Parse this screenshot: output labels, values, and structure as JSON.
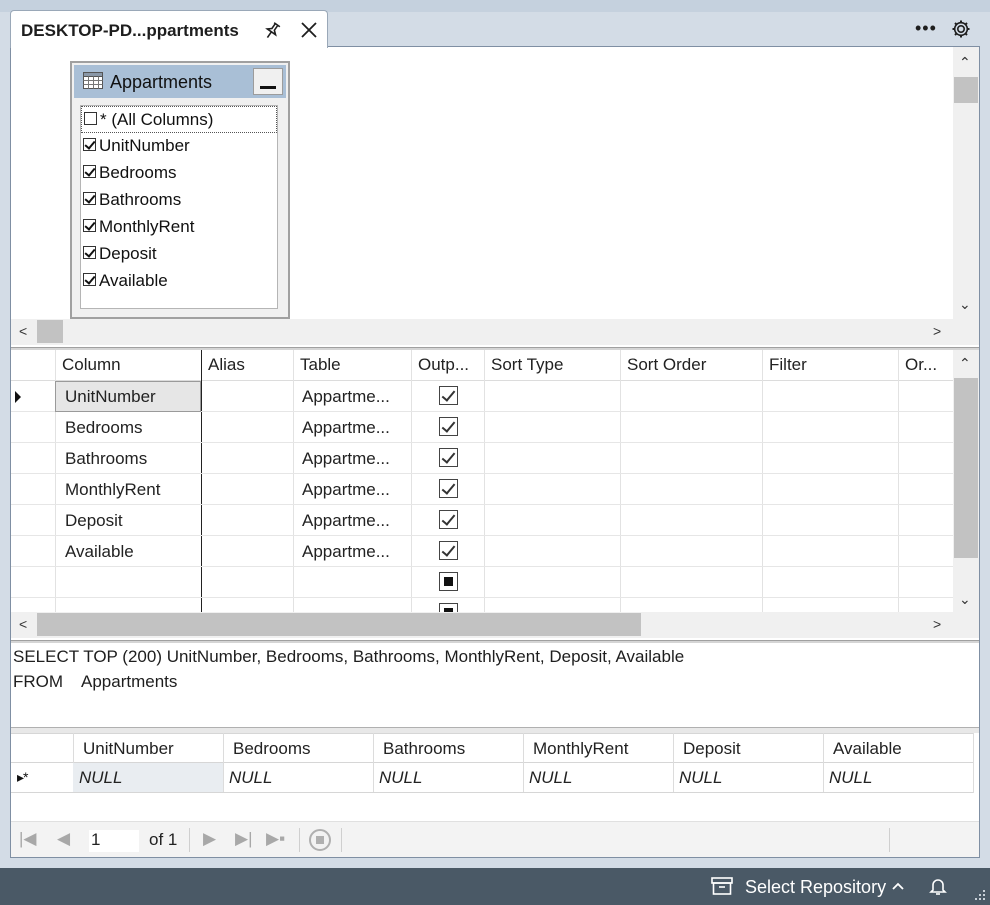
{
  "tab": {
    "title": "DESKTOP-PD...ppartments"
  },
  "diagram": {
    "table_name": "Appartments",
    "columns": [
      {
        "label": "* (All Columns)",
        "checked": false
      },
      {
        "label": "UnitNumber",
        "checked": true
      },
      {
        "label": "Bedrooms",
        "checked": true
      },
      {
        "label": "Bathrooms",
        "checked": true
      },
      {
        "label": "MonthlyRent",
        "checked": true
      },
      {
        "label": "Deposit",
        "checked": true
      },
      {
        "label": "Available",
        "checked": true
      }
    ]
  },
  "criteria": {
    "headers": [
      "Column",
      "Alias",
      "Table",
      "Outp...",
      "Sort Type",
      "Sort Order",
      "Filter",
      "Or..."
    ],
    "rows": [
      {
        "column": "UnitNumber",
        "alias": "",
        "table": "Appartme...",
        "output": "checked"
      },
      {
        "column": "Bedrooms",
        "alias": "",
        "table": "Appartme...",
        "output": "checked"
      },
      {
        "column": "Bathrooms",
        "alias": "",
        "table": "Appartme...",
        "output": "checked"
      },
      {
        "column": "MonthlyRent",
        "alias": "",
        "table": "Appartme...",
        "output": "checked"
      },
      {
        "column": "Deposit",
        "alias": "",
        "table": "Appartme...",
        "output": "checked"
      },
      {
        "column": "Available",
        "alias": "",
        "table": "Appartme...",
        "output": "checked"
      },
      {
        "column": "",
        "alias": "",
        "table": "",
        "output": "indeterminate"
      }
    ]
  },
  "sql": {
    "line1": "SELECT TOP (200) UnitNumber, Bedrooms, Bathrooms, MonthlyRent, Deposit, Available",
    "line2": "FROM    Appartments"
  },
  "results": {
    "headers": [
      "UnitNumber",
      "Bedrooms",
      "Bathrooms",
      "MonthlyRent",
      "Deposit",
      "Available"
    ],
    "row": [
      "NULL",
      "NULL",
      "NULL",
      "NULL",
      "NULL",
      "NULL"
    ],
    "new_row_indicator": "▸*"
  },
  "navigator": {
    "page": "1",
    "of_label": "of 1"
  },
  "status": {
    "repo_label": "Select Repository"
  },
  "colors": {
    "status_bar": "#4a5966",
    "table_header": "#a9bfd6",
    "accent": "#c5d1de"
  }
}
